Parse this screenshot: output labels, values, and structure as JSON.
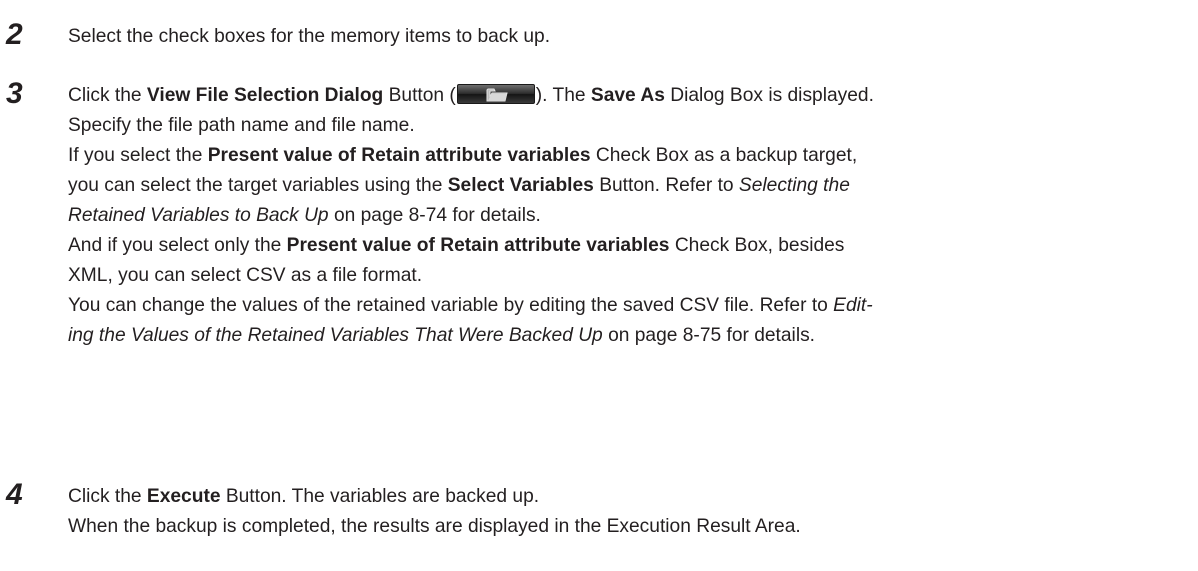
{
  "steps": [
    {
      "number": "2",
      "text": "Select the check boxes for the memory items to back up."
    },
    {
      "number": "3",
      "l1": {
        "a": "Click the ",
        "b": "View File Selection Dialog",
        "c": " Button (",
        "d": "). The ",
        "e": "Save As",
        "f": " Dialog Box is displayed."
      },
      "l2": "Specify the file path name and file name.",
      "l3": {
        "a": "If you select the ",
        "b": "Present value of Retain attribute variables",
        "c": " Check Box as a backup target,"
      },
      "l4": {
        "a": "you can select the target variables using the ",
        "b": "Select Variables",
        "c": " Button. Refer to ",
        "d": "Selecting the"
      },
      "l5": {
        "a": "Retained Variables to Back Up",
        "b": " on page 8-74 for details."
      },
      "l6": {
        "a": "And if you select only the ",
        "b": "Present value of Retain attribute variables",
        "c": " Check Box, besides"
      },
      "l7": "XML, you can select CSV as a file format.",
      "l8": {
        "a": "You can change the values of the retained variable by editing the saved CSV file. Refer to ",
        "b": "Edit-"
      },
      "l9": {
        "a": "ing the Values of the Retained Variables That Were Backed Up",
        "b": " on page 8-75 for details."
      }
    },
    {
      "number": "4",
      "l1": {
        "a": "Click the ",
        "b": "Execute",
        "c": " Button. The variables are backed up."
      },
      "l2": "When the backup is completed, the results are displayed in the Execution Result Area."
    }
  ],
  "icons": {
    "folder_button": "folder-open-icon"
  }
}
